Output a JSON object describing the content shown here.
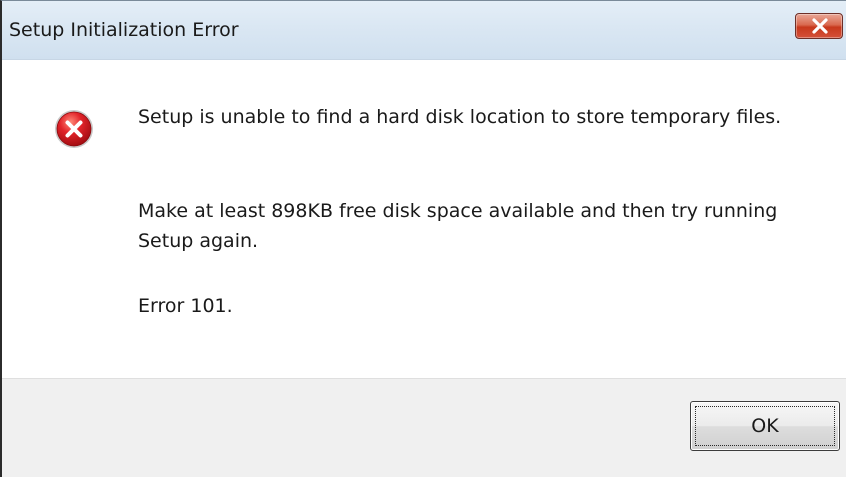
{
  "dialog": {
    "title": "Setup Initialization Error",
    "close_icon": "close-icon",
    "error_icon": "error-icon",
    "message_line_1": "Setup is unable to find a hard disk location to store temporary files.",
    "message_line_2": "Make at least 898KB free disk space available and then try running Setup again.",
    "message_line_3": "Error 101.",
    "ok_label": "OK"
  },
  "colors": {
    "title_bar": "#d9e6f3",
    "close_button": "#c7381c",
    "error_icon": "#c8141a",
    "footer": "#f0f0f0"
  }
}
